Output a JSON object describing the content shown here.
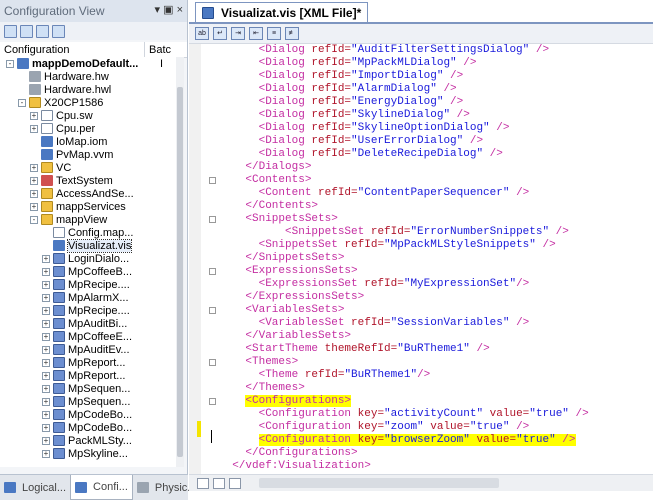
{
  "left": {
    "title": "Configuration View",
    "title_controls": "▾ ▣ ×",
    "col_config": "Configuration",
    "col_batch": "Batc",
    "tree": [
      {
        "label": "mappDemoDefault...",
        "level": 0,
        "exp": "-",
        "icon": "project",
        "bold": true,
        "extra": "I"
      },
      {
        "label": "Hardware.hw",
        "level": 1,
        "exp": "",
        "icon": "hardware"
      },
      {
        "label": "Hardware.hwl",
        "level": 1,
        "exp": "",
        "icon": "hardware"
      },
      {
        "label": "X20CP1586",
        "level": 1,
        "exp": "-",
        "icon": "folder"
      },
      {
        "label": "Cpu.sw",
        "level": 2,
        "exp": "+",
        "icon": "doc"
      },
      {
        "label": "Cpu.per",
        "level": 2,
        "exp": "+",
        "icon": "doc"
      },
      {
        "label": "IoMap.iom",
        "level": 2,
        "exp": "",
        "icon": "blue"
      },
      {
        "label": "PvMap.vvm",
        "level": 2,
        "exp": "",
        "icon": "blue"
      },
      {
        "label": "VC",
        "level": 2,
        "exp": "+",
        "icon": "folder"
      },
      {
        "label": "TextSystem",
        "level": 2,
        "exp": "+",
        "icon": "red"
      },
      {
        "label": "AccessAndSe...",
        "level": 2,
        "exp": "+",
        "icon": "folder"
      },
      {
        "label": "mappServices",
        "level": 2,
        "exp": "+",
        "icon": "folder"
      },
      {
        "label": "mappView",
        "level": 2,
        "exp": "-",
        "icon": "folder"
      },
      {
        "label": "Config.map...",
        "level": 3,
        "exp": "",
        "icon": "doc"
      },
      {
        "label": "Visualizat.vis",
        "level": 3,
        "exp": "",
        "icon": "blue",
        "selected": true
      },
      {
        "label": "LoginDialo...",
        "level": 3,
        "exp": "+",
        "icon": "pen"
      },
      {
        "label": "MpCoffeeB...",
        "level": 3,
        "exp": "+",
        "icon": "pen"
      },
      {
        "label": "MpRecipe....",
        "level": 3,
        "exp": "+",
        "icon": "pen"
      },
      {
        "label": "MpAlarmX...",
        "level": 3,
        "exp": "+",
        "icon": "pen"
      },
      {
        "label": "MpRecipe....",
        "level": 3,
        "exp": "+",
        "icon": "pen"
      },
      {
        "label": "MpAuditBi...",
        "level": 3,
        "exp": "+",
        "icon": "pen"
      },
      {
        "label": "MpCoffeeE...",
        "level": 3,
        "exp": "+",
        "icon": "pen"
      },
      {
        "label": "MpAuditEv...",
        "level": 3,
        "exp": "+",
        "icon": "pen"
      },
      {
        "label": "MpReport...",
        "level": 3,
        "exp": "+",
        "icon": "pen"
      },
      {
        "label": "MpReport...",
        "level": 3,
        "exp": "+",
        "icon": "pen"
      },
      {
        "label": "MpSequen...",
        "level": 3,
        "exp": "+",
        "icon": "pen"
      },
      {
        "label": "MpSequen...",
        "level": 3,
        "exp": "+",
        "icon": "pen"
      },
      {
        "label": "MpCodeBo...",
        "level": 3,
        "exp": "+",
        "icon": "pen"
      },
      {
        "label": "MpCodeBo...",
        "level": 3,
        "exp": "+",
        "icon": "pen"
      },
      {
        "label": "PackMLSty...",
        "level": 3,
        "exp": "+",
        "icon": "pen"
      },
      {
        "label": "MpSkyline...",
        "level": 3,
        "exp": "+",
        "icon": "pen"
      }
    ],
    "tabs": [
      "Logical...",
      "Confi...",
      "Physic..."
    ]
  },
  "editor": {
    "tab_title": "Visualizat.vis [XML File]*",
    "lines": [
      {
        "indent": "      ",
        "parts": [
          [
            "tag",
            "<Dialog "
          ],
          [
            "at",
            "refId="
          ],
          [
            "av",
            "\"AuditFilterSettingsDialog\""
          ],
          [
            "tag",
            " />"
          ]
        ]
      },
      {
        "indent": "      ",
        "parts": [
          [
            "tag",
            "<Dialog "
          ],
          [
            "at",
            "refId="
          ],
          [
            "av",
            "\"MpPackMLDialog\""
          ],
          [
            "tag",
            " />"
          ]
        ]
      },
      {
        "indent": "      ",
        "parts": [
          [
            "tag",
            "<Dialog "
          ],
          [
            "at",
            "refId="
          ],
          [
            "av",
            "\"ImportDialog\""
          ],
          [
            "tag",
            " />"
          ]
        ]
      },
      {
        "indent": "      ",
        "parts": [
          [
            "tag",
            "<Dialog "
          ],
          [
            "at",
            "refId="
          ],
          [
            "av",
            "\"AlarmDialog\""
          ],
          [
            "tag",
            " />"
          ]
        ]
      },
      {
        "indent": "      ",
        "parts": [
          [
            "tag",
            "<Dialog "
          ],
          [
            "at",
            "refId="
          ],
          [
            "av",
            "\"EnergyDialog\""
          ],
          [
            "tag",
            " />"
          ]
        ]
      },
      {
        "indent": "      ",
        "parts": [
          [
            "tag",
            "<Dialog "
          ],
          [
            "at",
            "refId="
          ],
          [
            "av",
            "\"SkylineDialog\""
          ],
          [
            "tag",
            " />"
          ]
        ]
      },
      {
        "indent": "      ",
        "parts": [
          [
            "tag",
            "<Dialog "
          ],
          [
            "at",
            "refId="
          ],
          [
            "av",
            "\"SkylineOptionDialog\""
          ],
          [
            "tag",
            " />"
          ]
        ]
      },
      {
        "indent": "      ",
        "parts": [
          [
            "tag",
            "<Dialog "
          ],
          [
            "at",
            "refId="
          ],
          [
            "av",
            "\"UserErrorDialog\""
          ],
          [
            "tag",
            " />"
          ]
        ]
      },
      {
        "indent": "      ",
        "parts": [
          [
            "tag",
            "<Dialog "
          ],
          [
            "at",
            "refId="
          ],
          [
            "av",
            "\"DeleteRecipeDialog\""
          ],
          [
            "tag",
            " />"
          ]
        ]
      },
      {
        "indent": "    ",
        "parts": [
          [
            "tag",
            "</Dialogs>"
          ]
        ]
      },
      {
        "indent": "    ",
        "parts": [
          [
            "tag",
            "<Contents>"
          ]
        ]
      },
      {
        "indent": "      ",
        "parts": [
          [
            "tag",
            "<Content "
          ],
          [
            "at",
            "refId="
          ],
          [
            "av",
            "\"ContentPaperSequencer\""
          ],
          [
            "tag",
            " />"
          ]
        ]
      },
      {
        "indent": "    ",
        "parts": [
          [
            "tag",
            "</Contents>"
          ]
        ]
      },
      {
        "indent": "    ",
        "parts": [
          [
            "tag",
            "<SnippetsSets>"
          ]
        ]
      },
      {
        "indent": "          ",
        "parts": [
          [
            "tag",
            "<SnippetsSet "
          ],
          [
            "at",
            "refId="
          ],
          [
            "av",
            "\"ErrorNumberSnippets\""
          ],
          [
            "tag",
            " />"
          ]
        ]
      },
      {
        "indent": "      ",
        "parts": [
          [
            "tag",
            "<SnippetsSet "
          ],
          [
            "at",
            "refId="
          ],
          [
            "av",
            "\"MpPackMLStyleSnippets\""
          ],
          [
            "tag",
            " />"
          ]
        ]
      },
      {
        "indent": "    ",
        "parts": [
          [
            "tag",
            "</SnippetsSets>"
          ]
        ]
      },
      {
        "indent": "    ",
        "parts": [
          [
            "tag",
            "<ExpressionsSets>"
          ]
        ]
      },
      {
        "indent": "      ",
        "parts": [
          [
            "tag",
            "<ExpressionsSet "
          ],
          [
            "at",
            "refId="
          ],
          [
            "av",
            "\"MyExpressionSet\""
          ],
          [
            "tag",
            "/>"
          ]
        ]
      },
      {
        "indent": "    ",
        "parts": [
          [
            "tag",
            "</ExpressionsSets>"
          ]
        ]
      },
      {
        "indent": "    ",
        "parts": [
          [
            "tag",
            "<VariablesSets>"
          ]
        ]
      },
      {
        "indent": "      ",
        "parts": [
          [
            "tag",
            "<VariablesSet "
          ],
          [
            "at",
            "refId="
          ],
          [
            "av",
            "\"SessionVariables\""
          ],
          [
            "tag",
            " />"
          ]
        ]
      },
      {
        "indent": "    ",
        "parts": [
          [
            "tag",
            "</VariablesSets>"
          ]
        ]
      },
      {
        "indent": "    ",
        "parts": [
          [
            "tag",
            "<StartTheme "
          ],
          [
            "at",
            "themeRefId="
          ],
          [
            "av",
            "\"BuRTheme1\""
          ],
          [
            "tag",
            " />"
          ]
        ]
      },
      {
        "indent": "    ",
        "parts": [
          [
            "tag",
            "<Themes>"
          ]
        ]
      },
      {
        "indent": "      ",
        "parts": [
          [
            "tag",
            "<Theme "
          ],
          [
            "at",
            "refId="
          ],
          [
            "av",
            "\"BuRTheme1\""
          ],
          [
            "tag",
            "/>"
          ]
        ]
      },
      {
        "indent": "    ",
        "parts": [
          [
            "tag",
            "</Themes>"
          ]
        ]
      },
      {
        "indent": "    ",
        "hl": true,
        "parts": [
          [
            "tag",
            "<Configurations>"
          ]
        ]
      },
      {
        "indent": "      ",
        "parts": [
          [
            "tag",
            "<Configuration "
          ],
          [
            "at",
            "key="
          ],
          [
            "av",
            "\"activityCount\""
          ],
          [
            "at",
            " value="
          ],
          [
            "av",
            "\"true\""
          ],
          [
            "tag",
            " />"
          ]
        ]
      },
      {
        "indent": "      ",
        "parts": [
          [
            "tag",
            "<Configuration "
          ],
          [
            "at",
            "key="
          ],
          [
            "av",
            "\"zoom\""
          ],
          [
            "at",
            " value="
          ],
          [
            "av",
            "\"true\""
          ],
          [
            "tag",
            " />"
          ]
        ]
      },
      {
        "indent": "      ",
        "hl": true,
        "parts": [
          [
            "tag",
            "<Configuration "
          ],
          [
            "at",
            "key="
          ],
          [
            "av",
            "\"browserZoom\""
          ],
          [
            "at",
            " value="
          ],
          [
            "av",
            "\"true\""
          ],
          [
            "tag",
            " />"
          ]
        ]
      },
      {
        "indent": "    ",
        "parts": [
          [
            "tag",
            "</Configurations>"
          ]
        ]
      },
      {
        "indent": "  ",
        "parts": [
          [
            "tag",
            "</vdef:Visualization>"
          ]
        ]
      }
    ]
  }
}
